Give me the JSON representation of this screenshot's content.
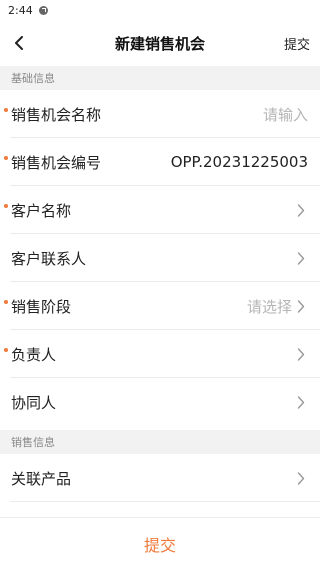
{
  "status_bar": {
    "time": "2:44",
    "notification_icon": "circle-icon"
  },
  "nav": {
    "title": "新建销售机会",
    "action_label": "提交",
    "back_icon": "chevron-left-icon"
  },
  "sections": {
    "basic": {
      "title": "基础信息"
    },
    "sales": {
      "title": "销售信息"
    }
  },
  "fields": {
    "opportunity_name": {
      "label": "销售机会名称",
      "placeholder": "请输入",
      "required": true
    },
    "opportunity_number": {
      "label": "销售机会编号",
      "value": "OPP.20231225003",
      "required": true
    },
    "customer_name": {
      "label": "客户名称",
      "required": true
    },
    "customer_contact": {
      "label": "客户联系人",
      "required": false
    },
    "sales_stage": {
      "label": "销售阶段",
      "placeholder": "请选择",
      "required": true
    },
    "owner": {
      "label": "负责人",
      "required": true
    },
    "collaborator": {
      "label": "协同人",
      "required": false
    },
    "related_products": {
      "label": "关联产品",
      "required": false
    }
  },
  "footer": {
    "submit_label": "提交"
  },
  "colors": {
    "accent": "#f07a3a",
    "section_bg": "#f2f2f2",
    "placeholder": "#b5b5b5"
  }
}
